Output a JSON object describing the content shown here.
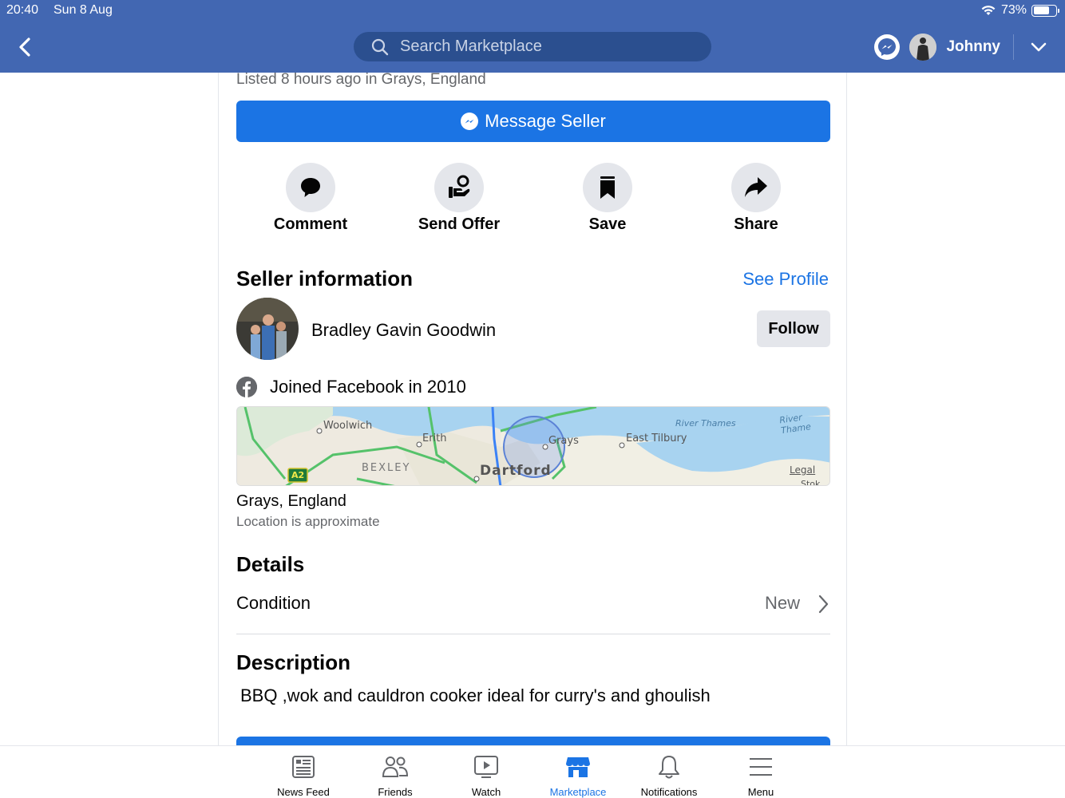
{
  "status": {
    "time": "20:40",
    "date": "Sun 8 Aug",
    "battery": "73%",
    "battery_level": 0.73
  },
  "nav": {
    "search_placeholder": "Search Marketplace",
    "username": "Johnny"
  },
  "listing": {
    "listed": "Listed 8 hours ago in Grays, England",
    "message_button": "Message Seller"
  },
  "actions": [
    {
      "label": "Comment",
      "icon": "comment-icon"
    },
    {
      "label": "Send Offer",
      "icon": "send-offer-icon"
    },
    {
      "label": "Save",
      "icon": "bookmark-icon"
    },
    {
      "label": "Share",
      "icon": "share-icon"
    }
  ],
  "seller": {
    "section_title": "Seller information",
    "see_profile": "See Profile",
    "name": "Bradley Gavin Goodwin",
    "follow": "Follow",
    "joined": "Joined Facebook in 2010"
  },
  "map": {
    "labels": [
      "Woolwich",
      "Erith",
      "Grays",
      "East Tilbury",
      "River Thames",
      "River Thame",
      "BEXLEY",
      "Dartford",
      "Legal",
      "A2",
      "Stok"
    ]
  },
  "location": {
    "city": "Grays, England",
    "note": "Location is approximate"
  },
  "details": {
    "title": "Details",
    "condition_label": "Condition",
    "condition_value": "New"
  },
  "description": {
    "title": "Description",
    "text": "BBQ ,wok and cauldron cooker ideal for curry's and ghoulish"
  },
  "tabs": [
    {
      "label": "News Feed",
      "icon": "news-feed-icon"
    },
    {
      "label": "Friends",
      "icon": "friends-icon"
    },
    {
      "label": "Watch",
      "icon": "watch-icon"
    },
    {
      "label": "Marketplace",
      "icon": "marketplace-icon",
      "active": true
    },
    {
      "label": "Notifications",
      "icon": "bell-icon"
    },
    {
      "label": "Menu",
      "icon": "menu-icon"
    }
  ],
  "colors": {
    "header": "#4267b2",
    "accent": "#1b74e4",
    "muted": "#65676b",
    "chip": "#e4e6eb"
  }
}
